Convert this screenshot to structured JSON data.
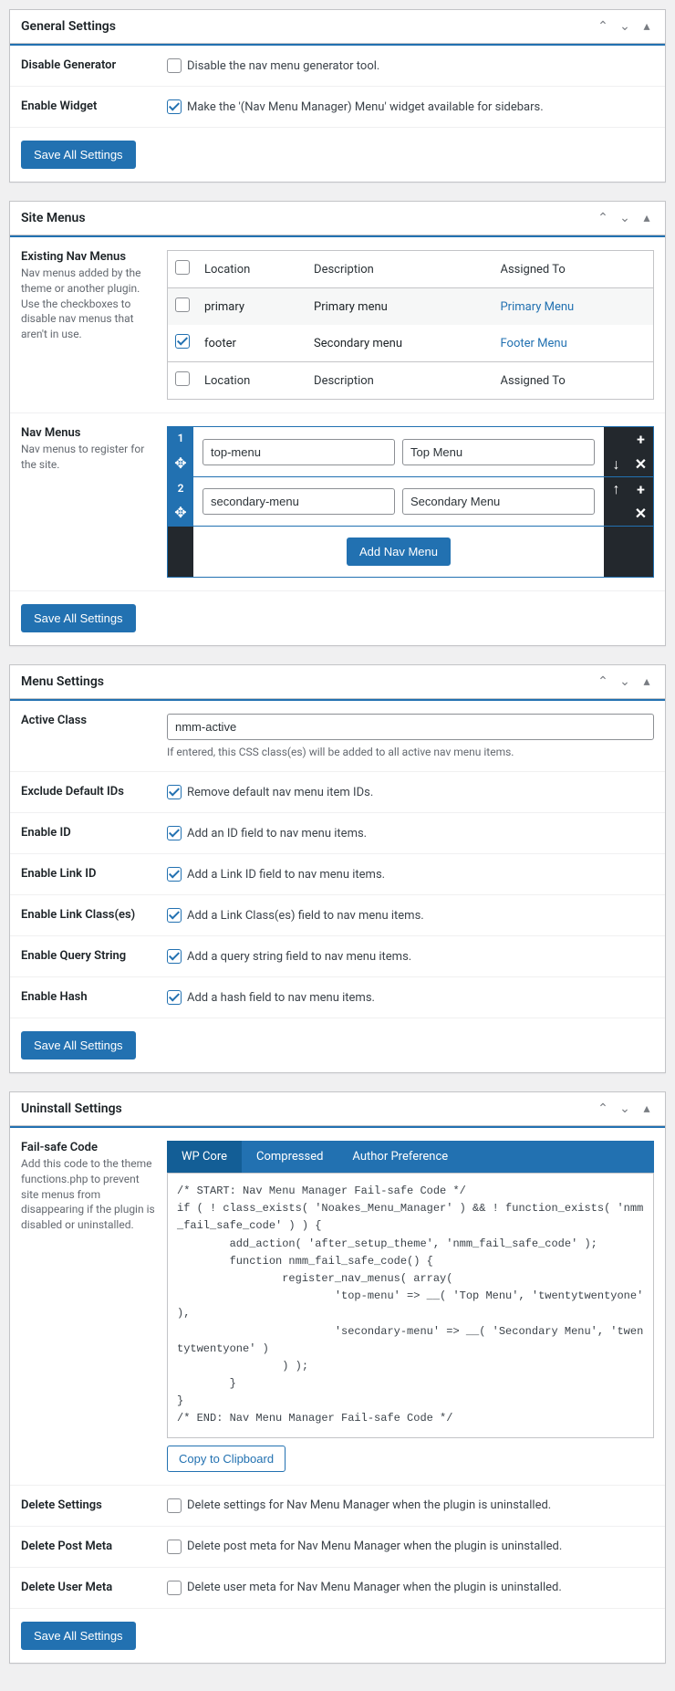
{
  "general": {
    "title": "General Settings",
    "disable_gen_label": "Disable Generator",
    "disable_gen_text": "Disable the nav menu generator tool.",
    "enable_widget_label": "Enable Widget",
    "enable_widget_text": "Make the '(Nav Menu Manager) Menu' widget available for sidebars.",
    "save": "Save All Settings"
  },
  "site_menus": {
    "title": "Site Menus",
    "existing_label": "Existing Nav Menus",
    "existing_desc": "Nav menus added by the theme or another plugin. Use the checkboxes to disable nav menus that aren't in use.",
    "cols": {
      "loc": "Location",
      "desc": "Description",
      "asg": "Assigned To"
    },
    "rows": [
      {
        "loc": "primary",
        "desc": "Primary menu",
        "asg": "Primary Menu",
        "checked": false
      },
      {
        "loc": "footer",
        "desc": "Secondary menu",
        "asg": "Footer Menu",
        "checked": true
      }
    ],
    "nav_label": "Nav Menus",
    "nav_desc": "Nav menus to register for the site.",
    "items": [
      {
        "slug": "top-menu",
        "name": "Top Menu"
      },
      {
        "slug": "secondary-menu",
        "name": "Secondary Menu"
      }
    ],
    "add_btn": "Add Nav Menu",
    "save": "Save All Settings"
  },
  "menu_settings": {
    "title": "Menu Settings",
    "active_class_label": "Active Class",
    "active_class_value": "nmm-active",
    "active_class_hint": "If entered, this CSS class(es) will be added to all active nav menu items.",
    "exclude_label": "Exclude Default IDs",
    "exclude_text": "Remove default nav menu item IDs.",
    "enable_id_label": "Enable ID",
    "enable_id_text": "Add an ID field to nav menu items.",
    "enable_linkid_label": "Enable Link ID",
    "enable_linkid_text": "Add a Link ID field to nav menu items.",
    "enable_linkclass_label": "Enable Link Class(es)",
    "enable_linkclass_text": "Add a Link Class(es) field to nav menu items.",
    "enable_qs_label": "Enable Query String",
    "enable_qs_text": "Add a query string field to nav menu items.",
    "enable_hash_label": "Enable Hash",
    "enable_hash_text": "Add a hash field to nav menu items.",
    "save": "Save All Settings"
  },
  "uninstall": {
    "title": "Uninstall Settings",
    "failsafe_label": "Fail-safe Code",
    "failsafe_desc": "Add this code to the theme functions.php to prevent site menus from disappearing if the plugin is disabled or uninstalled.",
    "tabs": {
      "wp": "WP Core",
      "comp": "Compressed",
      "auth": "Author Preference"
    },
    "code": "/* START: Nav Menu Manager Fail-safe Code */\nif ( ! class_exists( 'Noakes_Menu_Manager' ) && ! function_exists( 'nmm_fail_safe_code' ) ) {\n        add_action( 'after_setup_theme', 'nmm_fail_safe_code' );\n        function nmm_fail_safe_code() {\n                register_nav_menus( array(\n                        'top-menu' => __( 'Top Menu', 'twentytwentyone' ),\n                        'secondary-menu' => __( 'Secondary Menu', 'twentytwentyone' )\n                ) );\n        }\n}\n/* END: Nav Menu Manager Fail-safe Code */",
    "copy": "Copy to Clipboard",
    "del_set_label": "Delete Settings",
    "del_set_text": "Delete settings for Nav Menu Manager when the plugin is uninstalled.",
    "del_post_label": "Delete Post Meta",
    "del_post_text": "Delete post meta for Nav Menu Manager when the plugin is uninstalled.",
    "del_user_label": "Delete User Meta",
    "del_user_text": "Delete user meta for Nav Menu Manager when the plugin is uninstalled.",
    "save": "Save All Settings"
  }
}
